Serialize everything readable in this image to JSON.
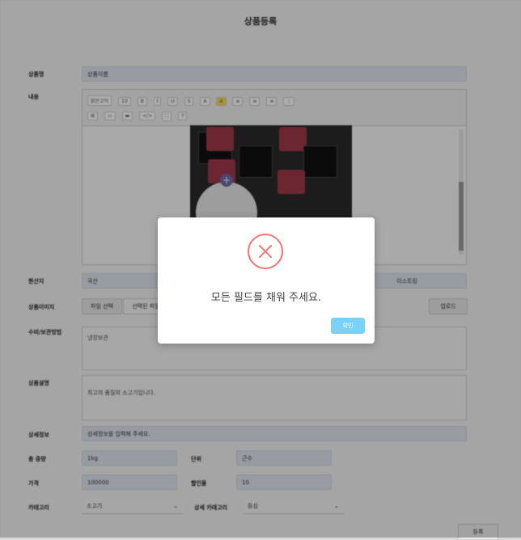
{
  "page": {
    "title": "상품등록",
    "labels": {
      "name": "상품명",
      "content": "내용",
      "origin": "원산지",
      "image": "상품이미지",
      "storage": "수비/보관방법",
      "description": "상품설명",
      "detail": "상세정보",
      "weight": "총 중량",
      "unit": "단위",
      "price": "가격",
      "discount": "할인율",
      "category": "카테고리",
      "subcategory": "상세 카테고리"
    },
    "values": {
      "name": "상품이름",
      "origin": "국산",
      "origin_right": "이스트링",
      "image_buttons": [
        "파일 선택",
        "선택된 파일 없음"
      ],
      "image_upload": "업로드",
      "storage": "냉장보관",
      "description": "최고의 품질의 소고기입니다.",
      "detail": "상세정보를 입력해 주세요.",
      "weight": "1kg",
      "unit": "근수",
      "price": "100000",
      "discount": "10",
      "category": "소고기",
      "subcategory": "등심"
    },
    "submit": "등록"
  },
  "toolbar": {
    "row1": [
      "맑은고딕",
      "10",
      "B",
      "I",
      "U",
      "S",
      "A",
      "A",
      "≡",
      "≡",
      "≡",
      "⋮"
    ],
    "row2": [
      "⊞",
      "▭",
      "▬",
      "</>",
      "⛶",
      "?"
    ]
  },
  "dialog": {
    "message": "모든 필드를 채워 주세요.",
    "ok": "확인",
    "error_color": "#f27474",
    "ok_color": "#7cd1f9"
  }
}
